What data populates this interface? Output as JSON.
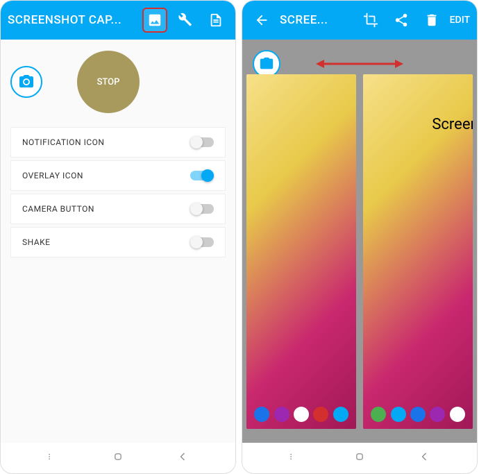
{
  "left": {
    "appbar": {
      "title": "SCREENSHOT CAP..."
    },
    "stop_label": "STOP",
    "settings": [
      {
        "label": "NOTIFICATION ICON",
        "on": false
      },
      {
        "label": "OVERLAY ICON",
        "on": true
      },
      {
        "label": "CAMERA BUTTON",
        "on": false
      },
      {
        "label": "SHAKE",
        "on": false
      }
    ]
  },
  "right": {
    "appbar": {
      "title": "SCREE...",
      "edit": "EDIT"
    },
    "thumb_annotation": "Screens"
  }
}
